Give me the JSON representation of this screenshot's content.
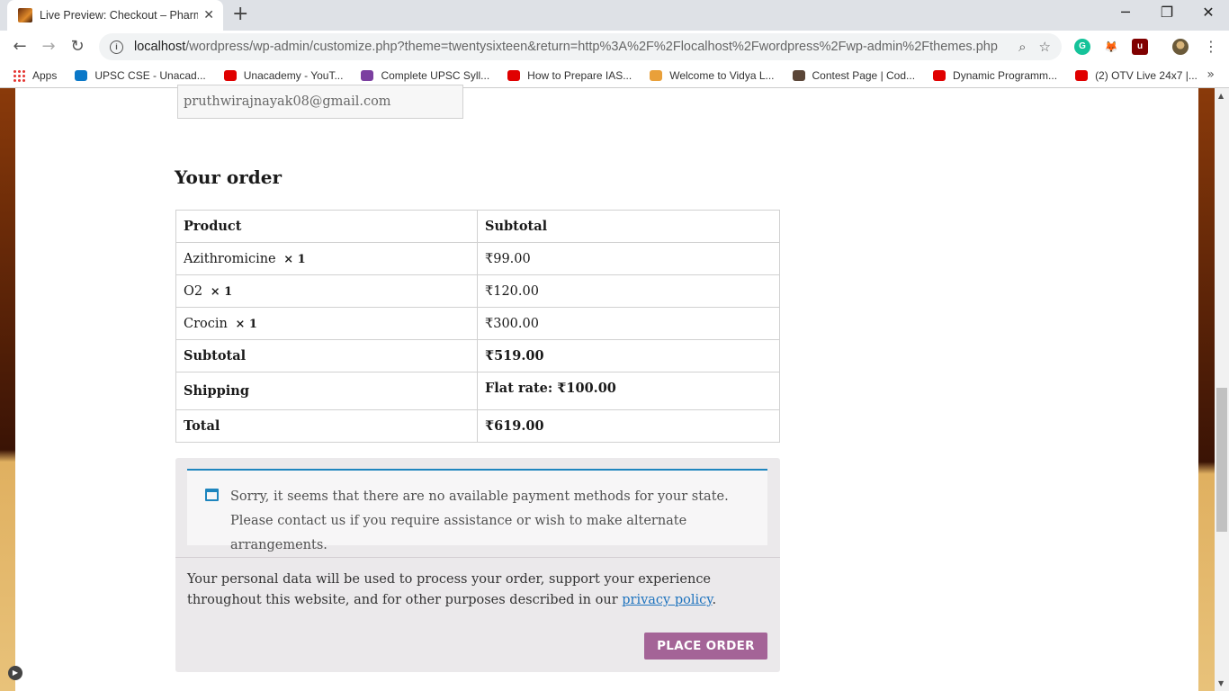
{
  "browser": {
    "tab": {
      "title": "Live Preview: Checkout – Pharma",
      "close_glyph": "✕"
    },
    "new_tab_glyph": "+",
    "window_controls": {
      "minimize": "─",
      "maximize": "❐",
      "close": "✕"
    },
    "nav": {
      "back": "←",
      "forward": "→",
      "reload": "↻"
    },
    "address": {
      "host": "localhost",
      "path": "/wordpress/wp-admin/customize.php?theme=twentysixteen&return=http%3A%2F%2Flocalhost%2Fwordpress%2Fwp-admin%2Fthemes.php"
    },
    "extensions": [
      {
        "icon": "grammarly-icon",
        "glyph": "G",
        "color": "#15c39a"
      },
      {
        "icon": "metamask-icon",
        "glyph": "🦊",
        "color": "#ffffff"
      },
      {
        "icon": "ublock-icon",
        "glyph": "u",
        "color": "#800000"
      },
      {
        "icon": "profile-avatar-icon",
        "glyph": "",
        "color": "#6b5a3a"
      }
    ],
    "menu_glyph": "⋮",
    "bookmarks": [
      {
        "label": "Apps",
        "icon": "apps-icon",
        "color": "#e53935"
      },
      {
        "label": "UPSC CSE - Unacad...",
        "icon": "unacademy-icon",
        "color": "#0a78c8"
      },
      {
        "label": "Unacademy - YouT...",
        "icon": "youtube-icon",
        "color": "#e00000"
      },
      {
        "label": "Complete UPSC Syll...",
        "icon": "bookmark-site-icon",
        "color": "#7b3fa0"
      },
      {
        "label": "How to Prepare IAS...",
        "icon": "youtube-icon",
        "color": "#e00000"
      },
      {
        "label": "Welcome to Vidya L...",
        "icon": "vidya-icon",
        "color": "#e9a03a"
      },
      {
        "label": "Contest Page | Cod...",
        "icon": "codechef-icon",
        "color": "#5b4638"
      },
      {
        "label": "Dynamic Programm...",
        "icon": "youtube-icon",
        "color": "#e00000"
      },
      {
        "label": "(2) OTV Live 24x7 |...",
        "icon": "youtube-icon",
        "color": "#e00000"
      }
    ],
    "bookmarks_more": "»"
  },
  "checkout": {
    "email_value": "pruthwirajnayak08@gmail.com",
    "order_heading": "Your order",
    "table": {
      "header": {
        "product": "Product",
        "subtotal": "Subtotal"
      },
      "items": [
        {
          "name": "Azithromicine",
          "qty": "× 1",
          "price": "₹99.00"
        },
        {
          "name": "O2",
          "qty": "× 1",
          "price": "₹120.00"
        },
        {
          "name": "Crocin",
          "qty": "× 1",
          "price": "₹300.00"
        }
      ],
      "subtotal": {
        "label": "Subtotal",
        "value": "₹519.00"
      },
      "shipping": {
        "label": "Shipping",
        "value": "Flat rate: ₹100.00"
      },
      "total": {
        "label": "Total",
        "value": "₹619.00"
      }
    },
    "payment_notice": "Sorry, it seems that there are no available payment methods for your state. Please contact us if you require assistance or wish to make alternate arrangements.",
    "privacy_text_before": "Your personal data will be used to process your order, support your experience throughout this website, and for other purposes described in our ",
    "privacy_link": "privacy policy",
    "privacy_text_after": ".",
    "place_order_label": "PLACE ORDER"
  },
  "colors": {
    "accent_purple": "#a46497",
    "notice_blue": "#1e85be",
    "link_blue": "#1e73be"
  }
}
